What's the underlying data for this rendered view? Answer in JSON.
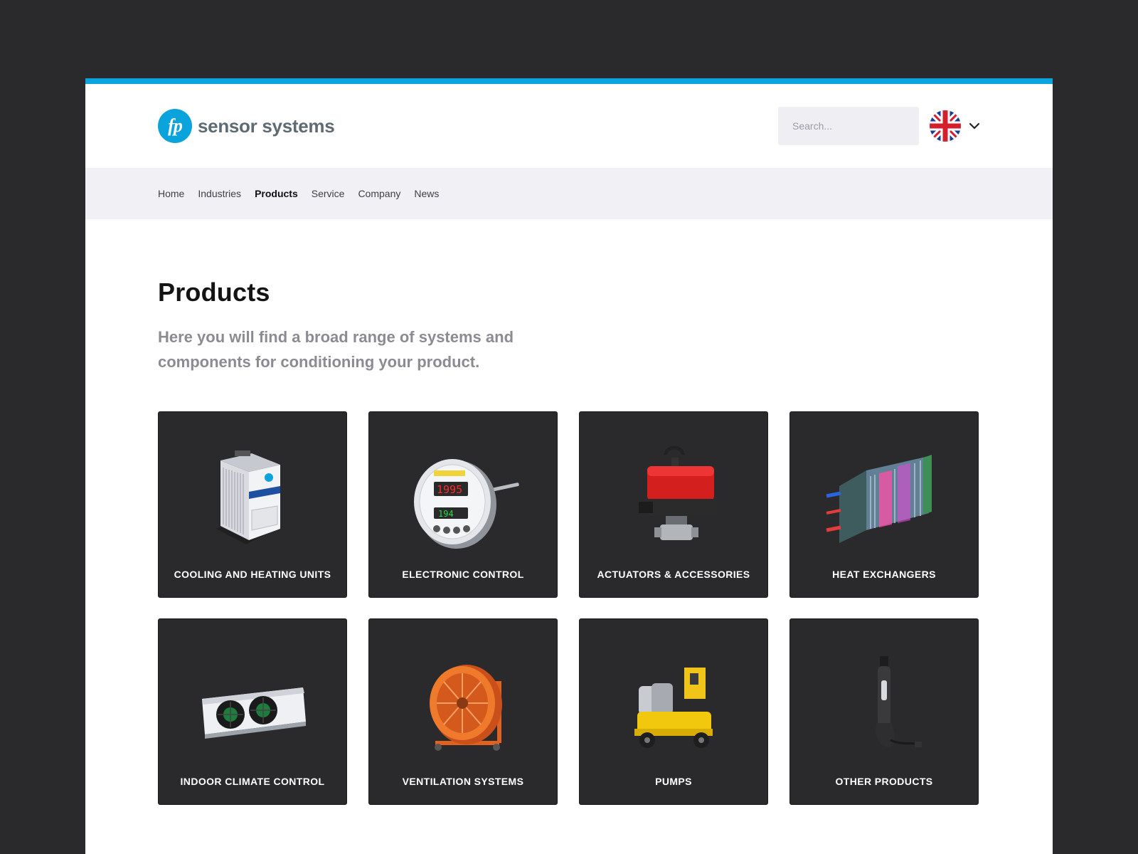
{
  "brand": {
    "logo_mark": "fp",
    "name": "sensor systems",
    "accent": "#0aa3db"
  },
  "search": {
    "placeholder": "Search..."
  },
  "language": {
    "current_flag": "uk-flag-icon",
    "toggle_icon": "chevron-down-icon"
  },
  "nav": {
    "items": [
      {
        "label": "Home"
      },
      {
        "label": "Industries"
      },
      {
        "label": "Products",
        "active": true
      },
      {
        "label": "Service"
      },
      {
        "label": "Company"
      },
      {
        "label": "News"
      }
    ]
  },
  "page": {
    "title": "Products",
    "intro": "Here you will find a broad range of systems and components for conditioning your product."
  },
  "products": [
    {
      "label": "COOLING AND HEATING UNITS",
      "icon": "chiller-unit-icon"
    },
    {
      "label": "ELECTRONIC CONTROL",
      "icon": "controller-gauge-icon"
    },
    {
      "label": "ACTUATORS & ACCESSORIES",
      "icon": "valve-actuator-icon"
    },
    {
      "label": "HEAT EXCHANGERS",
      "icon": "plate-heat-exchanger-icon"
    },
    {
      "label": "INDOOR CLIMATE CONTROL",
      "icon": "unit-cooler-icon"
    },
    {
      "label": "VENTILATION SYSTEMS",
      "icon": "axial-fan-icon"
    },
    {
      "label": "PUMPS",
      "icon": "pump-cart-icon"
    },
    {
      "label": "OTHER PRODUCTS",
      "icon": "probe-icon"
    }
  ]
}
